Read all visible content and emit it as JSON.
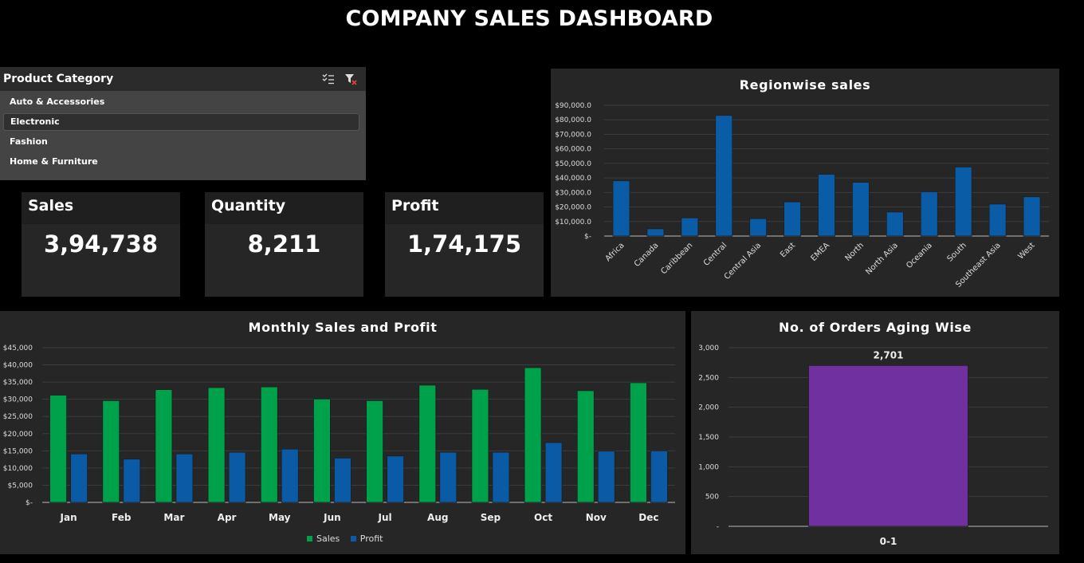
{
  "dashboard": {
    "title": "COMPANY SALES DASHBOARD"
  },
  "slicer": {
    "title": "Product Category",
    "items": [
      {
        "label": "Auto & Accessories",
        "selected": false
      },
      {
        "label": "Electronic",
        "selected": true
      },
      {
        "label": "Fashion",
        "selected": false
      },
      {
        "label": "Home & Furniture",
        "selected": false
      }
    ],
    "icons": [
      "multi-select-icon",
      "clear-filter-icon"
    ]
  },
  "kpis": {
    "sales": {
      "label": "Sales",
      "value": "3,94,738"
    },
    "quantity": {
      "label": "Quantity",
      "value": "8,211"
    },
    "profit": {
      "label": "Profit",
      "value": "1,74,175"
    }
  },
  "colors": {
    "background": "#000000",
    "panel": "#262626",
    "sales_green": "#00a14b",
    "profit_blue": "#0a5aa6",
    "region_blue": "#0b5ca7",
    "orders_purple": "#7030a0"
  },
  "chart_data": [
    {
      "id": "regionwise",
      "type": "bar",
      "title": "Regionwise sales",
      "categories": [
        "Africa",
        "Canada",
        "Caribbean",
        "Central",
        "Central Asia",
        "East",
        "EMEA",
        "North",
        "North Asia",
        "Oceania",
        "South",
        "Southeast Asia",
        "West"
      ],
      "values": [
        38000,
        5000,
        12500,
        83000,
        12000,
        23500,
        42500,
        37000,
        16500,
        30500,
        47500,
        22000,
        27000
      ],
      "ylim": [
        0,
        90000
      ],
      "yticks": [
        "$-",
        "$10,000.0",
        "$20,000.0",
        "$30,000.0",
        "$40,000.0",
        "$50,000.0",
        "$60,000.0",
        "$70,000.0",
        "$80,000.0",
        "$90,000.0"
      ],
      "grid": true
    },
    {
      "id": "monthly",
      "type": "bar",
      "title": "Monthly Sales and Profit",
      "categories": [
        "Jan",
        "Feb",
        "Mar",
        "Apr",
        "May",
        "Jun",
        "Jul",
        "Aug",
        "Sep",
        "Oct",
        "Nov",
        "Dec"
      ],
      "series": [
        {
          "name": "Sales",
          "values": [
            31200,
            29600,
            32800,
            33400,
            33600,
            30100,
            29600,
            34100,
            32900,
            39200,
            32500,
            34800
          ]
        },
        {
          "name": "Profit",
          "values": [
            14100,
            12600,
            14100,
            14600,
            15500,
            12900,
            13500,
            14600,
            14600,
            17400,
            14900,
            15000
          ]
        }
      ],
      "ylim": [
        0,
        45000
      ],
      "yticks": [
        "$-",
        "$5,000",
        "$10,000",
        "$15,000",
        "$20,000",
        "$25,000",
        "$30,000",
        "$35,000",
        "$40,000",
        "$45,000"
      ],
      "legend": "bottom",
      "grid": true
    },
    {
      "id": "orders",
      "type": "bar",
      "title": "No. of Orders Aging Wise",
      "categories": [
        "0-1"
      ],
      "values": [
        2701
      ],
      "data_labels": [
        "2,701"
      ],
      "ylim": [
        0,
        3000
      ],
      "yticks": [
        "-",
        "500",
        "1,000",
        "1,500",
        "2,000",
        "2,500",
        "3,000"
      ],
      "grid": true
    }
  ]
}
